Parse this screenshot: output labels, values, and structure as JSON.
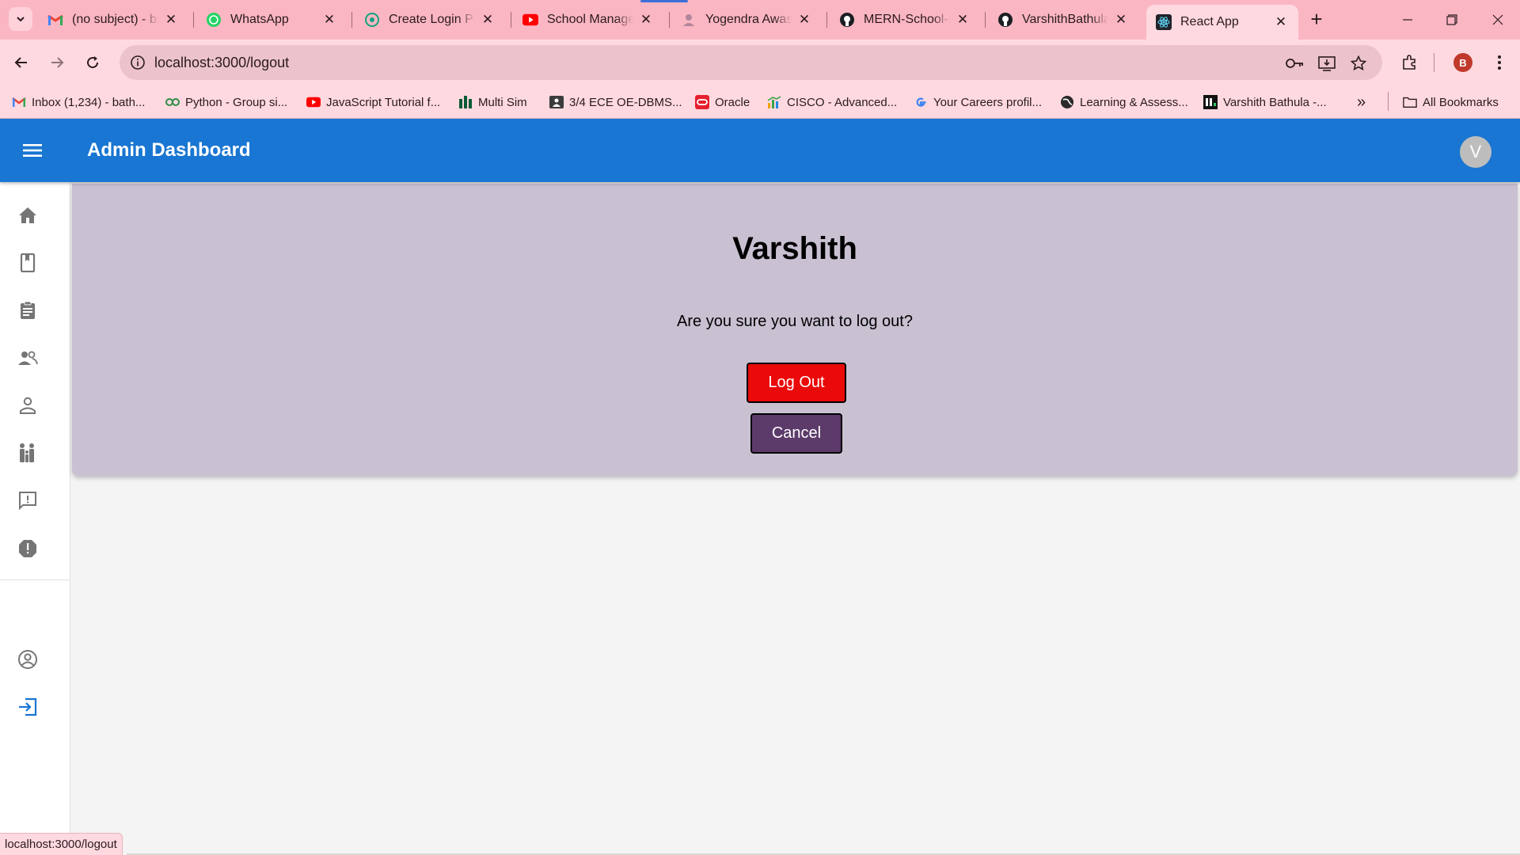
{
  "browser": {
    "tabs": [
      {
        "title": "(no subject) - bathula...",
        "icon": "gmail-icon",
        "active": false
      },
      {
        "title": "WhatsApp",
        "icon": "whatsapp-icon",
        "active": false
      },
      {
        "title": "Create Login Page",
        "icon": "chatgpt-icon",
        "active": false
      },
      {
        "title": "School Management",
        "icon": "youtube-icon",
        "active": false
      },
      {
        "title": "Yogendra Awasthi",
        "icon": "person-icon",
        "active": false
      },
      {
        "title": "MERN-School-Management",
        "icon": "github-icon",
        "active": false
      },
      {
        "title": "VarshithBathula",
        "icon": "github-icon",
        "active": false
      },
      {
        "title": "React App",
        "icon": "react-icon",
        "active": true
      }
    ],
    "url": "localhost:3000/logout",
    "profile_initial": "B",
    "bookmarks": [
      {
        "label": "Inbox (1,234) - bath...",
        "icon": "gmail-icon"
      },
      {
        "label": "Python - Group si...",
        "icon": "python-icon"
      },
      {
        "label": "JavaScript Tutorial f...",
        "icon": "youtube-icon"
      },
      {
        "label": "Multi Sim",
        "icon": "bars-icon"
      },
      {
        "label": "3/4 ECE OE-DBMS...",
        "icon": "classroom-icon"
      },
      {
        "label": "Oracle",
        "icon": "oracle-icon"
      },
      {
        "label": "CISCO - Advanced...",
        "icon": "chart-icon"
      },
      {
        "label": "Your Careers profil...",
        "icon": "google-icon"
      },
      {
        "label": "Learning & Assess...",
        "icon": "globe-icon"
      },
      {
        "label": "Varshith Bathula -...",
        "icon": "hackerrank-icon"
      }
    ],
    "more_bookmarks": "»",
    "all_bookmarks_label": "All Bookmarks",
    "status_url": "localhost:3000/logout"
  },
  "app": {
    "title": "Admin Dashboard",
    "avatar_initial": "V",
    "sidebar_icons": [
      "home-icon",
      "class-icon",
      "subject-icon",
      "teachers-icon",
      "student-icon",
      "family-icon",
      "feedback-icon",
      "complaint-icon",
      "account-icon",
      "logout-icon"
    ]
  },
  "logout": {
    "user_name": "Varshith",
    "prompt": "Are you sure you want to log out?",
    "logout_label": "Log Out",
    "cancel_label": "Cancel"
  },
  "colors": {
    "appbar": "#1976d2",
    "card": "#c9c1d2",
    "logout_button": "#ea0a0a",
    "cancel_button": "#5c3a6a",
    "browser_frame": "#fbb6c3"
  }
}
